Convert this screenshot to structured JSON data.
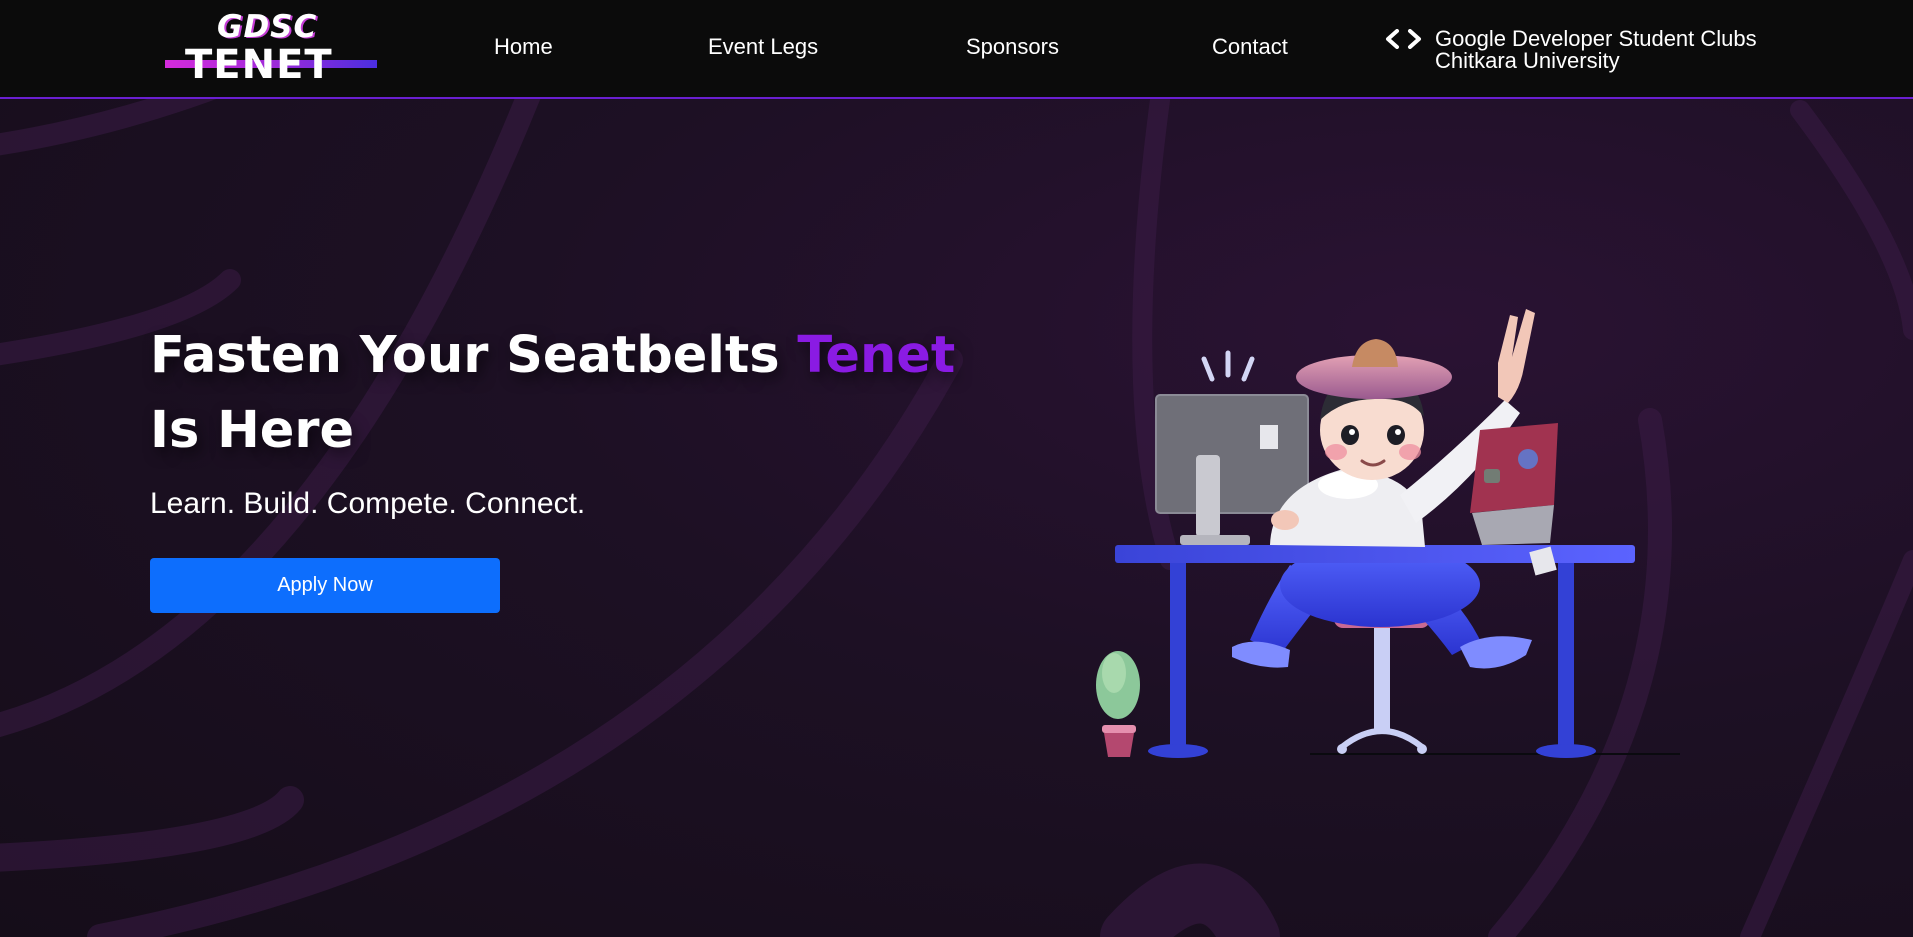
{
  "navbar": {
    "logo": {
      "top_text": "GDSC",
      "bottom_text": "TENET"
    },
    "links": [
      {
        "label": "Home"
      },
      {
        "label": "Event Legs"
      },
      {
        "label": "Sponsors"
      },
      {
        "label": "Contact"
      }
    ],
    "brand": {
      "icon": "gdsc-brackets-icon",
      "line1": "Google Developer Student Clubs",
      "line2": "Chitkara University"
    }
  },
  "hero": {
    "title_part1": "Fasten Your Seatbelts ",
    "title_accent": "Tenet",
    "title_part2": "Is Here",
    "subtitle": "Learn. Build. Compete. Connect.",
    "cta_label": "Apply Now",
    "illustration": "developer-at-desk-illustration"
  },
  "colors": {
    "accent_purple": "#8a1be3",
    "nav_border": "#6a1fd1",
    "button_blue": "#0d6efd",
    "background": "#170f1c"
  }
}
